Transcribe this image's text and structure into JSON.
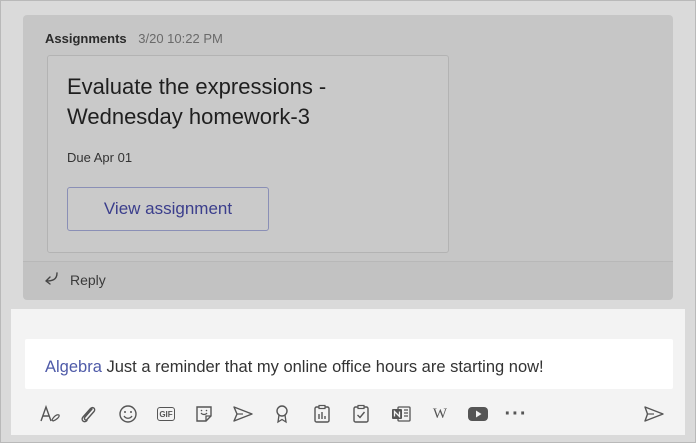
{
  "post": {
    "sender": "Assignments",
    "timestamp": "3/20 10:22 PM",
    "card": {
      "title": "Evaluate the expressions - Wednesday homework-3",
      "due": "Due Apr 01",
      "button_label": "View assignment"
    },
    "reply_label": "Reply"
  },
  "compose": {
    "mention": "Algebra",
    "text": "Just a reminder that my online office hours are starting now!"
  },
  "toolbar": {
    "icons": [
      "format-icon",
      "attach-icon",
      "emoji-icon",
      "gif-icon",
      "sticker-icon",
      "meet-now-icon",
      "praise-icon",
      "assignments-app-icon",
      "forms-app-icon",
      "onenote-app-icon",
      "wikipedia-app-icon",
      "youtube-app-icon",
      "more-options-icon",
      "send-icon"
    ],
    "gif_label": "GIF",
    "wiki_label": "W",
    "more_label": "···"
  }
}
